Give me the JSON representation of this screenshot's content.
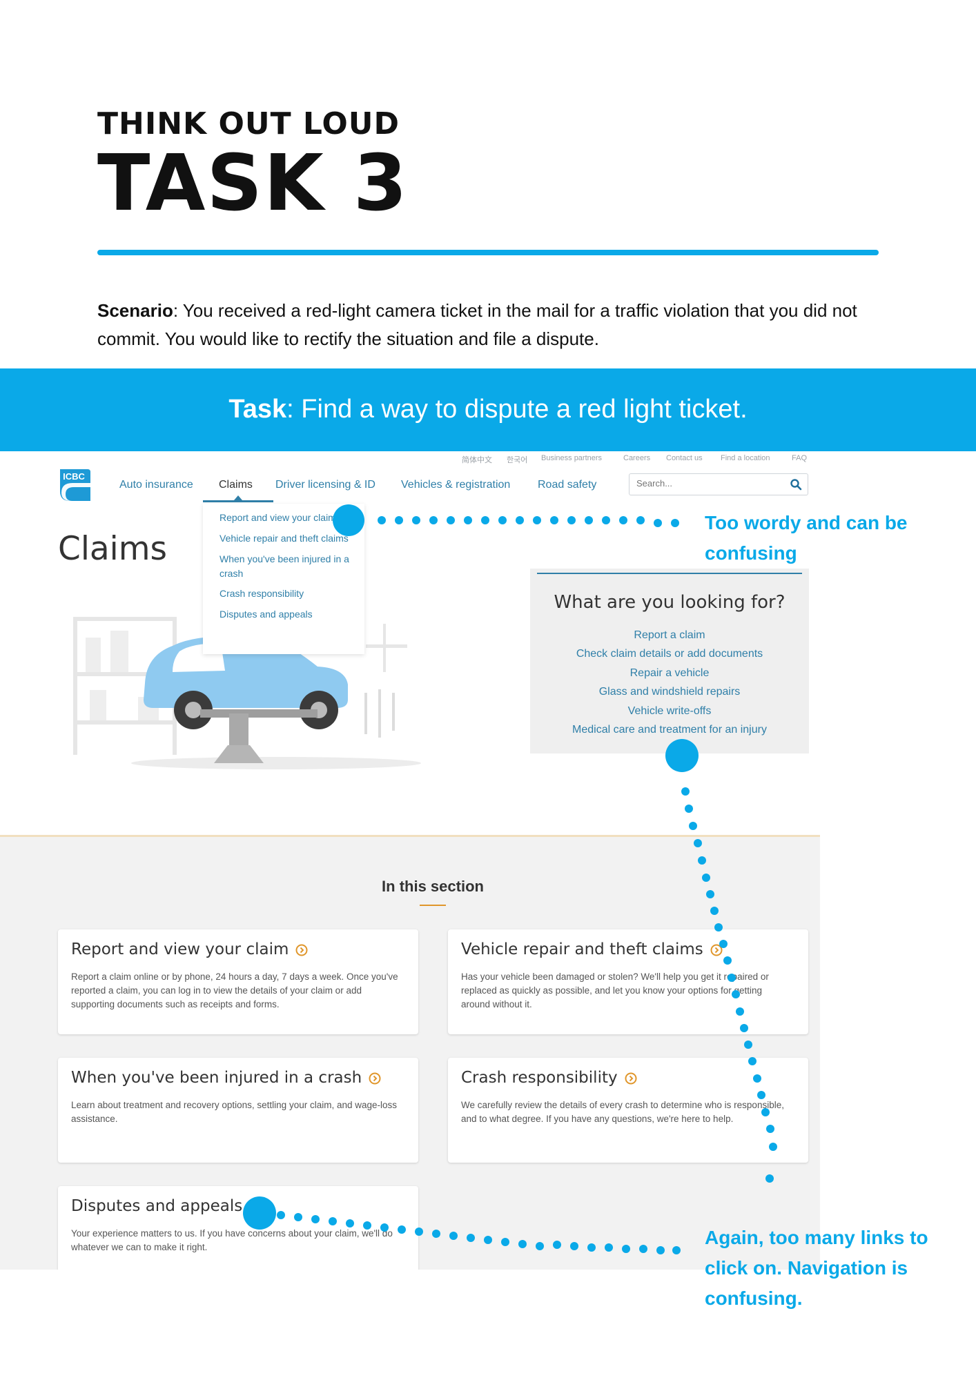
{
  "header": {
    "kicker": "THINK OUT LOUD",
    "title": "TASK 3"
  },
  "scenario": {
    "label": "Scenario",
    "text": ": You received a red-light camera ticket in the mail for a traffic violation that you did not commit. You would like to rectify the situation and file a dispute."
  },
  "task": {
    "label": "Task",
    "text": ": Find a way to dispute a red light ticket."
  },
  "site": {
    "utility_links": [
      "简体中文",
      "한국어",
      "Business partners",
      "Careers",
      "Contact us",
      "Find a location",
      "FAQ"
    ],
    "logo_text": "ICBC",
    "nav": [
      "Auto insurance",
      "Claims",
      "Driver licensing & ID",
      "Vehicles & registration",
      "Road safety"
    ],
    "search_placeholder": "Search...",
    "page_title": "Claims",
    "dropdown": [
      "Report and view your claim",
      "Vehicle repair and theft claims",
      "When you've been injured in a crash",
      "Crash responsibility",
      "Disputes and appeals"
    ],
    "looking_for": {
      "title": "What are you looking for?",
      "links": [
        "Report a claim",
        "Check claim details or add documents",
        "Repair a vehicle",
        "Glass and windshield repairs",
        "Vehicle write-offs",
        "Medical care and treatment for an injury"
      ]
    },
    "section_title": "In this section",
    "cards": [
      {
        "title": "Report and view your claim",
        "desc": "Report a claim online or by phone, 24 hours a day, 7 days a week. Once you've reported a claim, you can log in to view the details of your claim or add supporting documents such as receipts and forms."
      },
      {
        "title": "Vehicle repair and theft claims",
        "desc": "Has your vehicle been damaged or stolen? We'll help you get it repaired or replaced as quickly as possible, and let you know your options for getting around without it."
      },
      {
        "title": "When you've been injured in a crash",
        "desc": "Learn about treatment and recovery options, settling your claim, and wage-loss assistance."
      },
      {
        "title": "Crash responsibility",
        "desc": "We carefully review the details of every crash to determine who is responsible, and to what degree. If you have any questions, we're here to help."
      },
      {
        "title": "Disputes and appeals",
        "desc": "Your experience matters to us. If you have concerns about your claim, we'll do whatever we can to make it right."
      }
    ]
  },
  "annotations": {
    "note_1": "Too wordy and can be confusing",
    "note_2": "Again, too many links to click on. Navigation is confusing."
  },
  "colors": {
    "accent_blue": "#0aa9e8",
    "icbc_blue": "#2f7fa8",
    "icon_orange": "#e0962b"
  }
}
